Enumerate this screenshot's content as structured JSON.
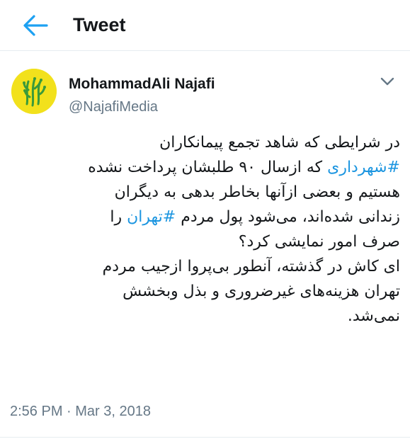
{
  "header": {
    "title": "Tweet",
    "back_icon": "arrow-left-icon"
  },
  "colors": {
    "accent": "#1b95e0",
    "text": "#14171a",
    "secondary_text": "#657786",
    "avatar_bg": "#f2e11c"
  },
  "tweet": {
    "author": {
      "name": "MohammadAli Najafi",
      "handle": "@NajafiMedia",
      "avatar_icon": "avatar-logo-icon"
    },
    "menu_icon": "chevron-down-icon",
    "text_lines": [
      {
        "segments": [
          {
            "text": "در شرایطی که شاهد تجمع پیمانکاران",
            "hashtag": false
          }
        ]
      },
      {
        "segments": [
          {
            "text": "#شهرداری",
            "hashtag": true
          },
          {
            "text": " که ازسال ۹۰ طلبشان پرداخت نشده",
            "hashtag": false
          }
        ]
      },
      {
        "segments": [
          {
            "text": "هستیم و بعضی ازآنها بخاطر بدهی به دیگران",
            "hashtag": false
          }
        ]
      },
      {
        "segments": [
          {
            "text": "زندانی شده‌اند، می‌شود پول مردم ",
            "hashtag": false
          },
          {
            "text": "#تهران",
            "hashtag": true
          },
          {
            "text": " را",
            "hashtag": false
          }
        ]
      },
      {
        "segments": [
          {
            "text": "صرف امور نمایشی کرد؟",
            "hashtag": false
          }
        ]
      },
      {
        "segments": [
          {
            "text": "ای کاش در گذشته، آنطور بی‌پروا ازجیب مردم",
            "hashtag": false
          }
        ]
      },
      {
        "segments": [
          {
            "text": "تهران هزینه‌های غیرضروری و بذل وبخشش",
            "hashtag": false
          }
        ]
      },
      {
        "segments": [
          {
            "text": "نمی‌شد.",
            "hashtag": false
          }
        ]
      }
    ],
    "timestamp": "2:56 PM · Mar 3, 2018"
  }
}
